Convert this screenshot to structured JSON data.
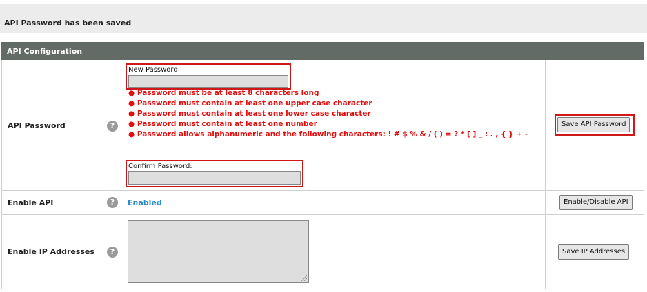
{
  "notice": {
    "message": "API Password has been saved"
  },
  "panel": {
    "title": "API Configuration"
  },
  "api_password": {
    "label": "API Password",
    "help_icon": "question-icon",
    "help_glyph": "?",
    "new_password_label": "New Password:",
    "confirm_password_label": "Confirm Password:",
    "rules": [
      "Password must be at least 8 characters long",
      "Password must contain at least one upper case character",
      "Password must contain at least one lower case character",
      "Password must contain at least one number",
      "Password allows alphanumeric and the following characters: ! # $ % & / ( ) = ? * [ ] _ : . , { } + -"
    ],
    "rule_bullet": "●",
    "save_label": "Save API Password"
  },
  "enable_api": {
    "label": "Enable API",
    "help_glyph": "?",
    "status": "Enabled",
    "status_color": "#2a8fc9",
    "toggle_label": "Enable/Disable API"
  },
  "enable_ip": {
    "label": "Enable IP Addresses",
    "help_glyph": "?",
    "save_label": "Save IP Addresses"
  },
  "colors": {
    "header_bg": "#626b66",
    "error_red": "#e30d0d",
    "highlight_red": "#d01818"
  }
}
